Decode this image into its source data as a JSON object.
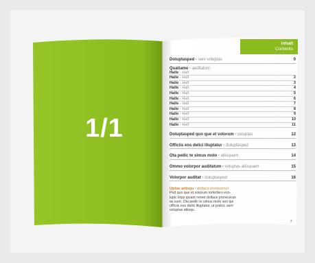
{
  "colors": {
    "brand_green": "#8bbc1f",
    "accent_orange": "#e27b1c",
    "background": "#e9e9e9"
  },
  "left_page": {
    "big_text": "1/1"
  },
  "header": {
    "title": "Inhalt",
    "subtitle": "Contents"
  },
  "toc": {
    "first": {
      "main": "Doluptasped",
      "sub": "seni voluptas",
      "page": "0"
    },
    "group": {
      "main": "Quatiame",
      "sub": "auditatum",
      "items": [
        {
          "main": "Halle",
          "sub": "Hall",
          "page": ""
        },
        {
          "main": "Halle",
          "sub": "Hall",
          "page": "2"
        },
        {
          "main": "Halle",
          "sub": "Hall",
          "page": "3"
        },
        {
          "main": "Halle",
          "sub": "Hall",
          "page": "4"
        },
        {
          "main": "Halle",
          "sub": "Hall",
          "page": "5"
        },
        {
          "main": "Halle",
          "sub": "Hall",
          "page": "6"
        },
        {
          "main": "Halle",
          "sub": "Hall",
          "page": "7"
        },
        {
          "main": "Halle",
          "sub": "Hall",
          "page": "8"
        },
        {
          "main": "Halle",
          "sub": "Hall",
          "page": "9"
        },
        {
          "main": "Halle",
          "sub": "Hall",
          "page": "10"
        },
        {
          "main": "Halle",
          "sub": "Hall",
          "page": "11"
        }
      ]
    },
    "entries": [
      {
        "main": "Doluptasped quo que et volorum",
        "sub": "voluptas",
        "page": "12"
      },
      {
        "main": "Officiis eos delici illuptatur",
        "sub": "doluptasped",
        "page": "13"
      },
      {
        "main": "Ota pedic te simus molo",
        "sub": "atiisquam",
        "page": "14"
      },
      {
        "main": "Ommo volorpor auditatum",
        "sub": "voluptas atiisquam",
        "page": "15"
      },
      {
        "main": "Volorpor auditat",
        "sub": "doluptasped",
        "page": "16"
      }
    ]
  },
  "note": {
    "title_main": "Uptas atiisqu",
    "title_sub": "dollace proreceruri",
    "lines": [
      "Ped quo que et volorum rorferfero evo-",
      "lupic iliqui ipsant remet dollace proreceran",
      "as sunt. Ota pedic te simus molo ven qui",
      "officiis eos delici illuptatur, ut pratur, sem",
      "voluptas atiisqu."
    ]
  },
  "page_number": "3"
}
